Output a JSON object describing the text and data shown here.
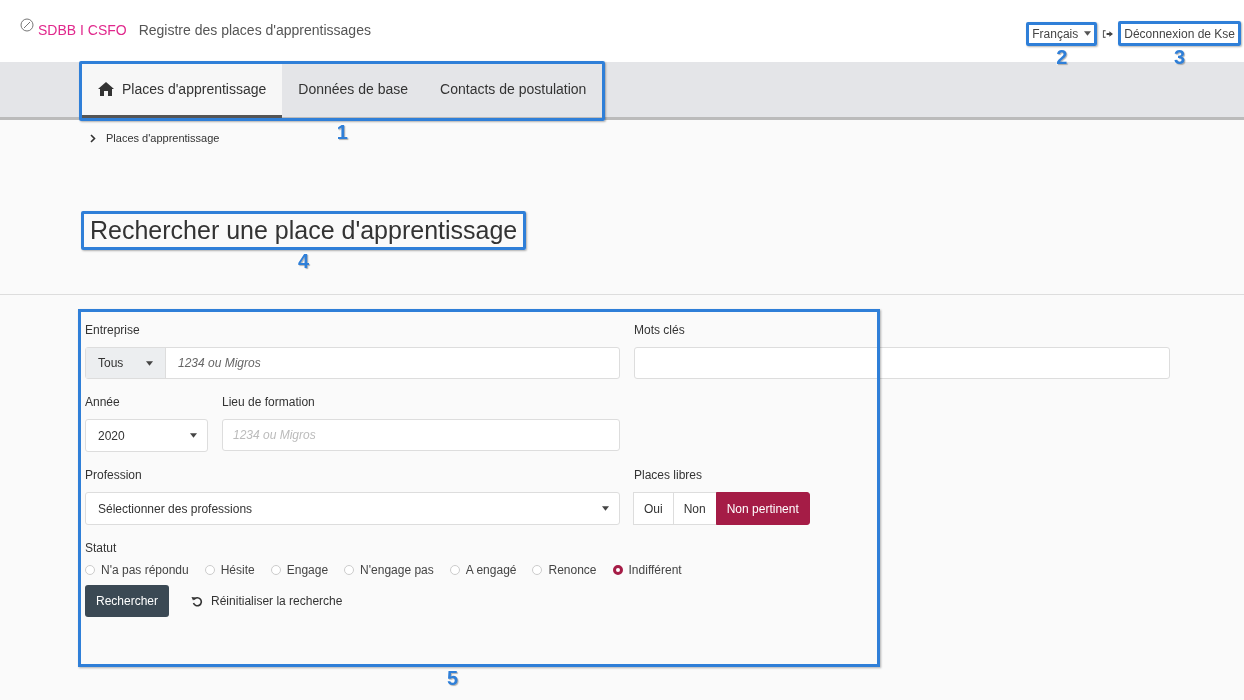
{
  "header": {
    "logo_text": "SDBB I CSFO",
    "app_title": "Registre des places d'apprentissages",
    "language": "Français",
    "logout": "Déconnexion de Kse"
  },
  "tabs": [
    {
      "label": "Places d'apprentissage",
      "selected": true
    },
    {
      "label": "Données de base",
      "selected": false
    },
    {
      "label": "Contacts de postulation",
      "selected": false
    }
  ],
  "breadcrumb": [
    "Places d'apprentissage"
  ],
  "page_title": "Rechercher une place d'apprentissage",
  "form": {
    "entreprise": {
      "label": "Entreprise",
      "scope": "Tous",
      "placeholder": "1234 ou Migros"
    },
    "keywords": {
      "label": "Mots clés"
    },
    "year": {
      "label": "Année",
      "value": "2020"
    },
    "place": {
      "label": "Lieu de formation",
      "placeholder": "1234 ou Migros"
    },
    "profession": {
      "label": "Profession",
      "value": "Sélectionner des professions"
    },
    "free_places": {
      "label": "Places libres",
      "options": [
        {
          "label": "Oui",
          "selected": false
        },
        {
          "label": "Non",
          "selected": false
        },
        {
          "label": "Non pertinent",
          "selected": true
        }
      ]
    },
    "status": {
      "label": "Statut",
      "options": [
        {
          "label": "N'a pas répondu",
          "selected": false
        },
        {
          "label": "Hésite",
          "selected": false
        },
        {
          "label": "Engage",
          "selected": false
        },
        {
          "label": "N'engage pas",
          "selected": false
        },
        {
          "label": "A engagé",
          "selected": false
        },
        {
          "label": "Renonce",
          "selected": false
        },
        {
          "label": "Indifférent",
          "selected": true
        }
      ]
    },
    "search_button": "Rechercher",
    "reset": "Réinitialiser la recherche"
  },
  "callouts": [
    "1",
    "2",
    "3",
    "4",
    "5"
  ]
}
